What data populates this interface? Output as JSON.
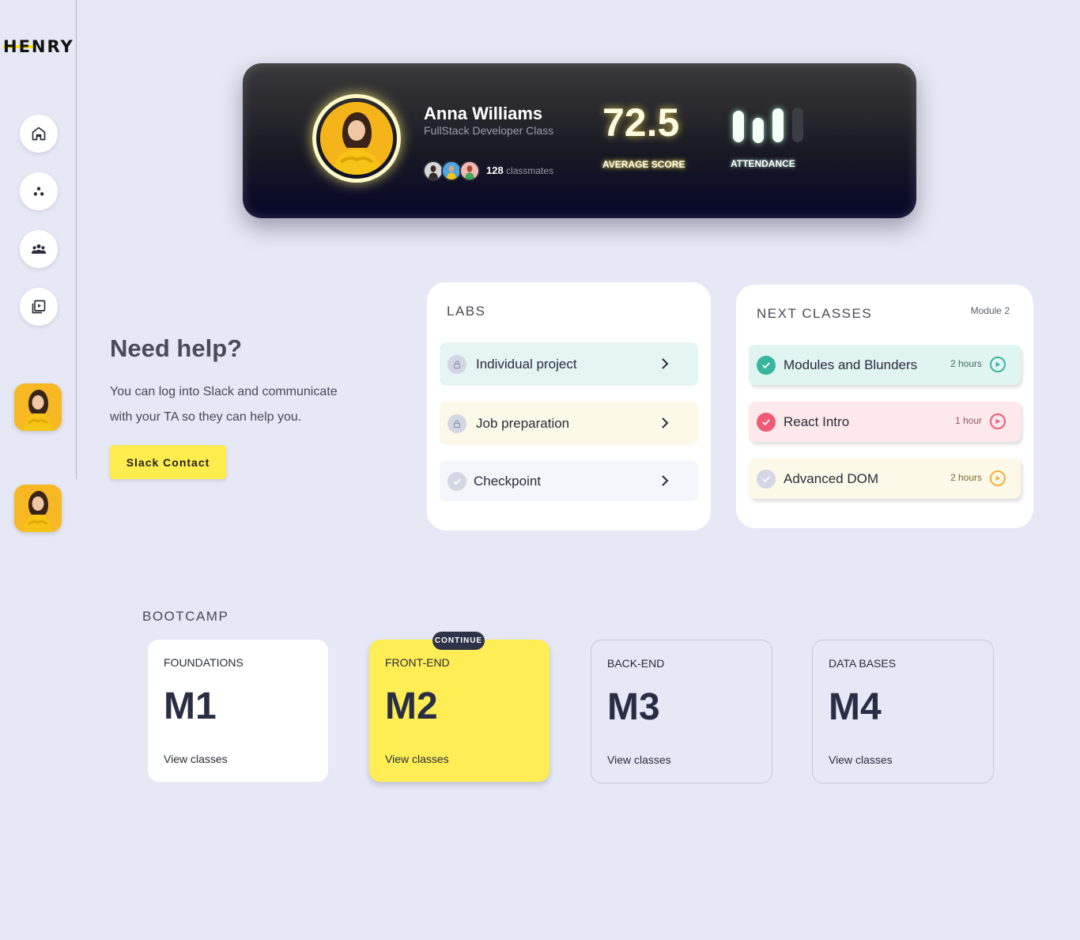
{
  "brand": {
    "logo": "HENRY"
  },
  "sidebar": {
    "nav": [
      {
        "name": "home",
        "icon": "home-icon"
      },
      {
        "name": "cohort",
        "icon": "dots-icon"
      },
      {
        "name": "people",
        "icon": "group-icon"
      },
      {
        "name": "videos",
        "icon": "video-library-icon"
      }
    ]
  },
  "profile": {
    "name": "Anna Williams",
    "class_name": "FullStack Developer Class",
    "classmates_count": "128",
    "classmates_label": "classmates",
    "average_score": "72.5",
    "average_score_label": "AVERAGE SCORE",
    "attendance_label": "ATTENDANCE",
    "attendance_bars_lit": 3,
    "attendance_bars_total": 4
  },
  "help": {
    "title": "Need help?",
    "text": "You can log into Slack and communicate with your TA so they can help you.",
    "button": "Slack Contact"
  },
  "labs": {
    "title": "LABS",
    "items": [
      {
        "label": "Individual project",
        "icon": "lock-icon",
        "color": "#e4f5f4"
      },
      {
        "label": "Job preparation",
        "icon": "lock-icon",
        "color": "#fdf9e9"
      },
      {
        "label": "Checkpoint",
        "icon": "check-icon",
        "color": "#f4f6fc"
      }
    ]
  },
  "next_classes": {
    "title": "NEXT CLASSES",
    "module": "Module 2",
    "items": [
      {
        "label": "Modules and Blunders",
        "duration": "2 hours",
        "status": "done",
        "accent": "#3ab59d",
        "bg": "#e0f4f1"
      },
      {
        "label": "React Intro",
        "duration": "1 hour",
        "status": "done",
        "accent": "#ef5a74",
        "bg": "#fde9ec"
      },
      {
        "label": "Advanced DOM",
        "duration": "2 hours",
        "status": "pending",
        "accent": "#f0b23a",
        "bg": "#fdf9e9"
      }
    ]
  },
  "bootcamp": {
    "title": "BOOTCAMP",
    "continue_badge": "CONTINUE",
    "modules": [
      {
        "category": "FOUNDATIONS",
        "code": "M1",
        "link": "View classes"
      },
      {
        "category": "FRONT-END",
        "code": "M2",
        "link": "View classes"
      },
      {
        "category": "BACK-END",
        "code": "M3",
        "link": "View classes"
      },
      {
        "category": "DATA BASES",
        "code": "M4",
        "link": "View classes"
      }
    ]
  }
}
